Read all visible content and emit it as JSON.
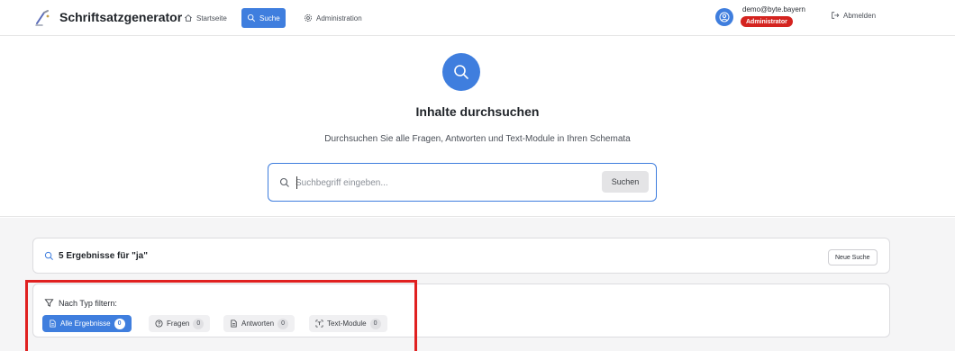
{
  "header": {
    "app_title": "Schriftsatzgenerator",
    "nav": {
      "home": "Startseite",
      "search": "Suche",
      "admin": "Administration"
    },
    "user": {
      "email": "demo@byte.bayern",
      "role": "Administrator"
    },
    "logout": "Abmelden"
  },
  "hero": {
    "title": "Inhalte durchsuchen",
    "subtitle": "Durchsuchen Sie alle Fragen, Antworten und Text-Module in Ihren Schemata",
    "search_placeholder": "Suchbegriff eingeben...",
    "search_button": "Suchen"
  },
  "results": {
    "count_text": "5 Ergebnisse für \"ja\"",
    "new_search": "Neue Suche",
    "filter_label": "Nach Typ filtern:",
    "filters": [
      {
        "label": "Alle Ergebnisse",
        "count": "0",
        "active": true
      },
      {
        "label": "Fragen",
        "count": "0",
        "active": false
      },
      {
        "label": "Antworten",
        "count": "0",
        "active": false
      },
      {
        "label": "Text-Module",
        "count": "0",
        "active": false
      }
    ]
  },
  "colors": {
    "accent": "#3f7ede",
    "badge": "#d4231f",
    "highlight": "#e02020"
  }
}
